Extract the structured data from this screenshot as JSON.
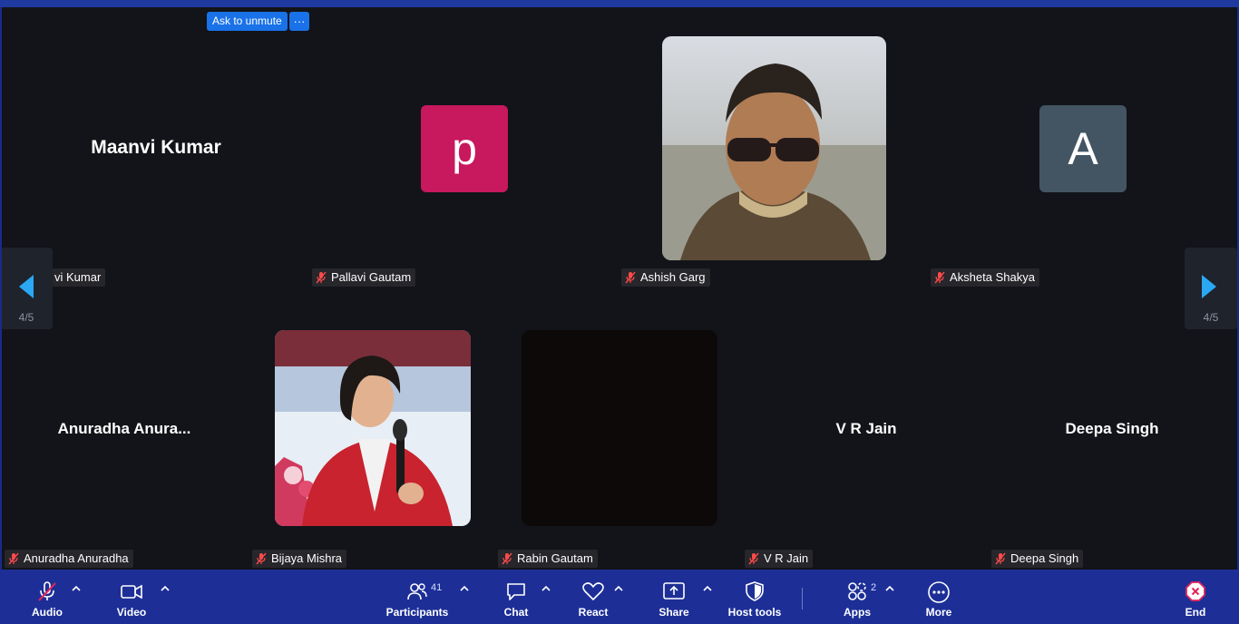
{
  "top_controls": {
    "ask_to_unmute": "Ask to unmute",
    "more_dots": "···"
  },
  "participants": [
    {
      "display": "Maanvi Kumar",
      "tag": "vi Kumar",
      "muted": false
    },
    {
      "display": "",
      "tag": "Pallavi Gautam",
      "avatar_letter": "p",
      "avatar_color": "#c8185e",
      "muted": true
    },
    {
      "display": "",
      "tag": "Ashish Garg",
      "muted": true
    },
    {
      "display": "",
      "tag": "Aksheta Shakya",
      "avatar_letter": "A",
      "avatar_color": "#435562",
      "muted": true
    },
    {
      "display": "Anuradha  Anura...",
      "tag": "Anuradha Anuradha",
      "muted": true
    },
    {
      "display": "",
      "tag": "Bijaya Mishra",
      "muted": true
    },
    {
      "display": "",
      "tag": "Rabin Gautam",
      "muted": true
    },
    {
      "display": "V R Jain",
      "tag": "V R Jain",
      "muted": true
    },
    {
      "display": "Deepa Singh",
      "tag": "Deepa Singh",
      "muted": true
    }
  ],
  "pager": {
    "left_count": "4/5",
    "right_count": "4/5"
  },
  "toolbar": {
    "audio": "Audio",
    "video": "Video",
    "participants": "Participants",
    "participants_count": "41",
    "chat": "Chat",
    "react": "React",
    "share": "Share",
    "host_tools": "Host tools",
    "apps": "Apps",
    "apps_count": "2",
    "more": "More",
    "end": "End"
  },
  "colors": {
    "toolbar_bg": "#1d2f97",
    "stage_bg": "#121419",
    "accent": "#1a72e8",
    "end_red": "#e5245a"
  }
}
